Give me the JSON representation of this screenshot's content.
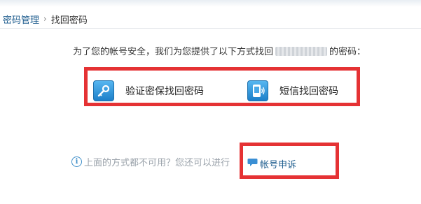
{
  "breadcrumb": {
    "parent": "密码管理",
    "separator": "›",
    "current": "找回密码"
  },
  "intro": {
    "before": "为了您的帐号安全，我们为您提供了以下方式找回",
    "after": "的密码："
  },
  "options": [
    {
      "label": "验证密保找回密码",
      "icon": "key-icon"
    },
    {
      "label": "短信找回密码",
      "icon": "phone-icon"
    }
  ],
  "alternative": {
    "text": "上面的方式都不可用？您还可以进行",
    "link_label": "帐号申诉",
    "info_icon": "info-icon",
    "link_icon": "chat-bubble-icon"
  },
  "colors": {
    "highlight": "#e53234",
    "link": "#1a5a8c",
    "icon_blue": "#2a8ad8"
  }
}
